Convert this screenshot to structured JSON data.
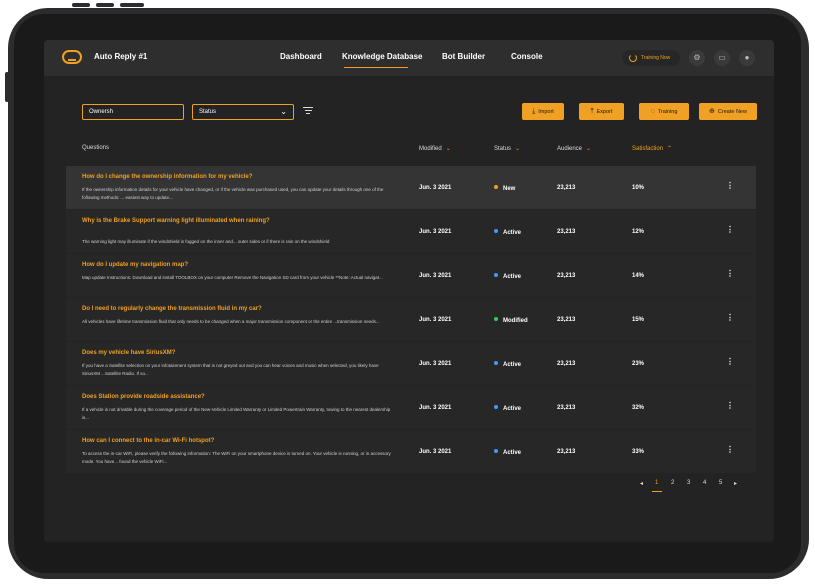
{
  "header": {
    "app_title": "Auto Reply #1",
    "nav": [
      "Dashboard",
      "Knowledge Database",
      "Bot Builder",
      "Console"
    ],
    "active_nav": "Knowledge Database",
    "training_now": "Training Now",
    "icons": [
      "gear-icon",
      "chat-icon",
      "user-icon"
    ]
  },
  "toolbar": {
    "search_value": "Ownersh",
    "status_label": "Status",
    "import_label": "Import",
    "export_label": "Export",
    "training_label": "Training",
    "create_label": "Create New"
  },
  "table": {
    "columns": [
      "Questions",
      "Modified",
      "Status",
      "Audience",
      "Satisfaction"
    ],
    "rows": [
      {
        "question": "How do I change the ownership information for my vehicle?",
        "answer": "If the ownership information details for your vehicle have changed, or if the vehicle was purchased used, you can update your details through one of the following methods: ... easiest way to update...",
        "modified": "Jun. 3 2021",
        "status": "New",
        "status_color": "#f0a022",
        "audience": "23,213",
        "satisfaction": "10%"
      },
      {
        "question": "Why is the Brake Support warning light illuminated when raining?",
        "answer": "The warning light may illuminate if the windshield is fogged on the inner and... outer sides or if there is rain on the windshield",
        "modified": "Jun. 3 2021",
        "status": "Active",
        "status_color": "#3b9dff",
        "audience": "23,213",
        "satisfaction": "12%"
      },
      {
        "question": "How do I update my navigation map?",
        "answer": "Map update Instructions: Download and install TOOLBOX on your computer Remove the Navigation SD card from your vehicle **Note: Actual navigat...",
        "modified": "Jun. 3 2021",
        "status": "Active",
        "status_color": "#3b9dff",
        "audience": "23,213",
        "satisfaction": "14%"
      },
      {
        "question": "Do I need to regularly change the transmission fluid in my car?",
        "answer": "All vehicles  have lifetime transmission fluid that only needs to be changed when a major transmission component or the entire ...transmission needs...",
        "modified": "Jun. 3 2021",
        "status": "Modified",
        "status_color": "#2ecc71",
        "audience": "23,213",
        "satisfaction": "15%"
      },
      {
        "question": "Does my vehicle have SiriusXM?",
        "answer": "If you have a Satellite selection on your infotainment system that is not greyed out and you can hear voices and music when selected, you likely have SiriusXM ...Satellite Radio. If so...",
        "modified": "Jun. 3 2021",
        "status": "Active",
        "status_color": "#3b9dff",
        "audience": "23,213",
        "satisfaction": "23%"
      },
      {
        "question": "Does Station provide roadside assistance?",
        "answer": "If a vehicle is not drivable during the coverage period of the New-Vehicle Limited Warranty or Limited Powertrain Warranty, towing to the nearest dealership is...",
        "modified": "Jun. 3 2021",
        "status": "Active",
        "status_color": "#3b9dff",
        "audience": "23,213",
        "satisfaction": "32%"
      },
      {
        "question": "How can I connect to the in-car Wi-Fi hotspot?",
        "answer": "To access the in-car WiFi, please verify the following information: The WiFi on your smartphone device is turned on. Your vehicle is running, or in accessory mode. You have... found the vehicle WiFi...",
        "modified": "Jun. 3 2021",
        "status": "Active",
        "status_color": "#3b9dff",
        "audience": "23,213",
        "satisfaction": "33%"
      }
    ]
  },
  "pagination": {
    "pages": [
      "1",
      "2",
      "3",
      "4",
      "5"
    ],
    "current": "1"
  },
  "colors": {
    "accent": "#f0a022",
    "background": "#232323"
  }
}
